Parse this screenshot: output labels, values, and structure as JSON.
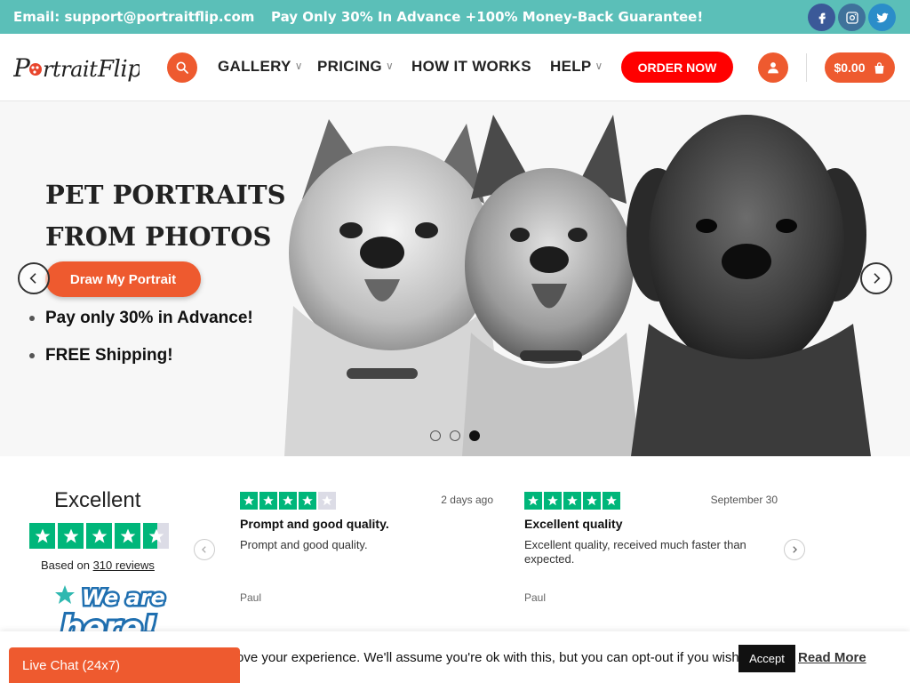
{
  "topbar": {
    "email": "Email: support@portraitflip.com",
    "promo": "Pay Only 30% In Advance +100% Money-Back Guarantee!",
    "social_icons": [
      "facebook-icon",
      "instagram-icon",
      "twitter-icon"
    ]
  },
  "header": {
    "logo_text": "PortraitFlip",
    "nav": [
      {
        "label": "GALLERY",
        "has_dropdown": true
      },
      {
        "label": "PRICING",
        "has_dropdown": true
      },
      {
        "label": "HOW IT WORKS",
        "has_dropdown": false
      },
      {
        "label": "HELP",
        "has_dropdown": true
      }
    ],
    "order_button": "ORDER NOW",
    "cart_total": "$0.00"
  },
  "hero": {
    "title_line1": "PET PORTRAITS",
    "title_line2": "FROM PHOTOS",
    "cta": "Draw My Portrait",
    "bullets": [
      "Pay only 30% in Advance!",
      "FREE Shipping!"
    ],
    "slide_count": 3,
    "active_slide": 3
  },
  "reviews": {
    "rating_word": "Excellent",
    "based_on_prefix": "Based on",
    "review_count_link": "310 reviews",
    "items": [
      {
        "stars": 4,
        "date": "2 days ago",
        "title": "Prompt and good quality.",
        "body": "Prompt and good quality.",
        "author": "Paul"
      },
      {
        "stars": 5,
        "date": "September 30",
        "title": "Excellent quality",
        "body": "Excellent quality, received much faster than expected.",
        "author": "Paul"
      }
    ]
  },
  "badge": {
    "text_line1": "We are",
    "text_line2": "here!"
  },
  "cookie": {
    "text": "ove your experience. We'll assume you're ok with this, but you can opt-out if you wish.",
    "accept": "Accept",
    "read_more": "Read More"
  },
  "livechat": {
    "label": "Live Chat (24x7)"
  },
  "colors": {
    "topbar": "#5bbfb8",
    "accent_orange": "#ee5a2f",
    "order_red": "#ff0000",
    "trustpilot_green": "#00b67a"
  }
}
